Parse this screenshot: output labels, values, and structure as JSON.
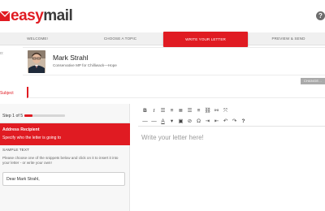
{
  "app": {
    "logo_red": "easy",
    "logo_dark": "mail",
    "help_icon": "question-circle-icon",
    "accent": "#e01b22"
  },
  "steps": [
    {
      "label": "Welcome!",
      "active": false
    },
    {
      "label": "Choose a topic",
      "active": false
    },
    {
      "label": "Write your letter",
      "active": true
    },
    {
      "label": "Preview & Send",
      "active": false
    }
  ],
  "recipient": {
    "label": "o:",
    "name": "Mark Strahl",
    "title": "Conservative MP for Chilliwack—Hope",
    "change_label": "Change..."
  },
  "subject": {
    "label": "Subject",
    "value": ""
  },
  "panel": {
    "step_text": "Step 1 of 5",
    "progress": 0.2,
    "heading": "Address Recipient",
    "subheading": "Specify who the letter is going to",
    "sample_label": "Sample text",
    "sample_help": "Please choose one of the snippets below and click on it to insert it into your letter - or write your own!",
    "snippet": "Dear Mark Strahl,"
  },
  "editor": {
    "placeholder": "Write your letter here!",
    "toolbar_row1": [
      {
        "name": "bold-icon",
        "glyph": "B",
        "cls": "b"
      },
      {
        "name": "italic-icon",
        "glyph": "I",
        "cls": "i"
      },
      {
        "name": "unordered-list-icon",
        "glyph": "☰",
        "cls": ""
      },
      {
        "name": "ordered-list-icon",
        "glyph": "≡",
        "cls": ""
      },
      {
        "name": "align-left-icon",
        "glyph": "≣",
        "cls": ""
      },
      {
        "name": "align-center-icon",
        "glyph": "☰",
        "cls": ""
      },
      {
        "name": "align-right-icon",
        "glyph": "≡",
        "cls": ""
      },
      {
        "name": "link-icon",
        "glyph": "⛓",
        "cls": ""
      },
      {
        "name": "unlink-icon",
        "glyph": "⚯",
        "cls": ""
      },
      {
        "name": "fullscreen-icon",
        "glyph": "⤧",
        "cls": ""
      }
    ],
    "toolbar_row2": [
      {
        "name": "horizontal-rule-icon",
        "glyph": "—",
        "cls": ""
      },
      {
        "name": "strikethrough-icon",
        "glyph": "―",
        "cls": ""
      },
      {
        "name": "text-color-icon",
        "glyph": "A",
        "cls": "u"
      },
      {
        "name": "chevron-down-icon",
        "glyph": "▾",
        "cls": ""
      },
      {
        "name": "paste-icon",
        "glyph": "▣",
        "cls": ""
      },
      {
        "name": "clear-format-icon",
        "glyph": "⊘",
        "cls": ""
      },
      {
        "name": "special-char-icon",
        "glyph": "Ω",
        "cls": ""
      },
      {
        "name": "indent-icon",
        "glyph": "⇥",
        "cls": ""
      },
      {
        "name": "outdent-icon",
        "glyph": "⇤",
        "cls": ""
      },
      {
        "name": "undo-icon",
        "glyph": "↶",
        "cls": ""
      },
      {
        "name": "redo-icon",
        "glyph": "↷",
        "cls": ""
      },
      {
        "name": "help-icon",
        "glyph": "?",
        "cls": "b"
      }
    ]
  }
}
